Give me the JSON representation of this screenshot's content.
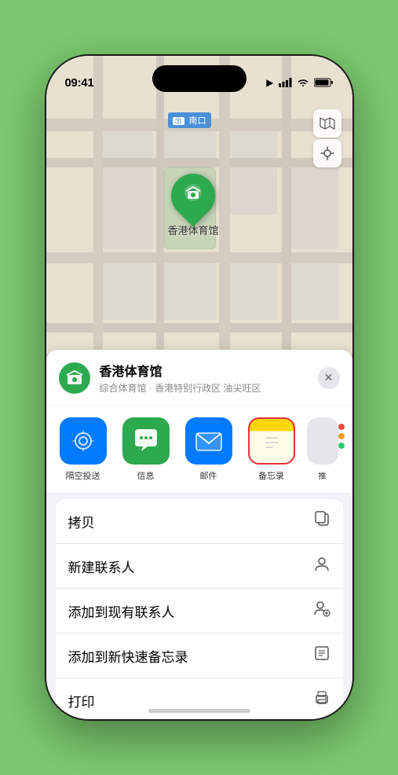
{
  "statusBar": {
    "time": "09:41",
    "locationIcon": "▶"
  },
  "map": {
    "label": "南口",
    "venuePinLabel": "香港体育馆"
  },
  "venueCard": {
    "name": "香港体育馆",
    "subtitle": "综合体育馆 · 香港特别行政区 油尖旺区",
    "closeLabel": "✕"
  },
  "shareApps": [
    {
      "key": "airdrop",
      "label": "隔空投送",
      "icon": "📶"
    },
    {
      "key": "messages",
      "label": "信息",
      "icon": "💬"
    },
    {
      "key": "mail",
      "label": "邮件",
      "icon": "✉"
    },
    {
      "key": "notes",
      "label": "备忘录",
      "icon": "📝",
      "highlighted": true
    },
    {
      "key": "more",
      "label": "推",
      "icon": "···"
    }
  ],
  "actionItems": [
    {
      "label": "拷贝",
      "iconUnicode": "⎘"
    },
    {
      "label": "新建联系人",
      "iconUnicode": "👤"
    },
    {
      "label": "添加到现有联系人",
      "iconUnicode": "👤"
    },
    {
      "label": "添加到新快速备忘录",
      "iconUnicode": "🗒"
    },
    {
      "label": "打印",
      "iconUnicode": "🖨"
    }
  ],
  "moreApps": {
    "colors": [
      "#e74c3c",
      "#f39c12",
      "#2ecc71"
    ]
  },
  "homeIndicator": ""
}
